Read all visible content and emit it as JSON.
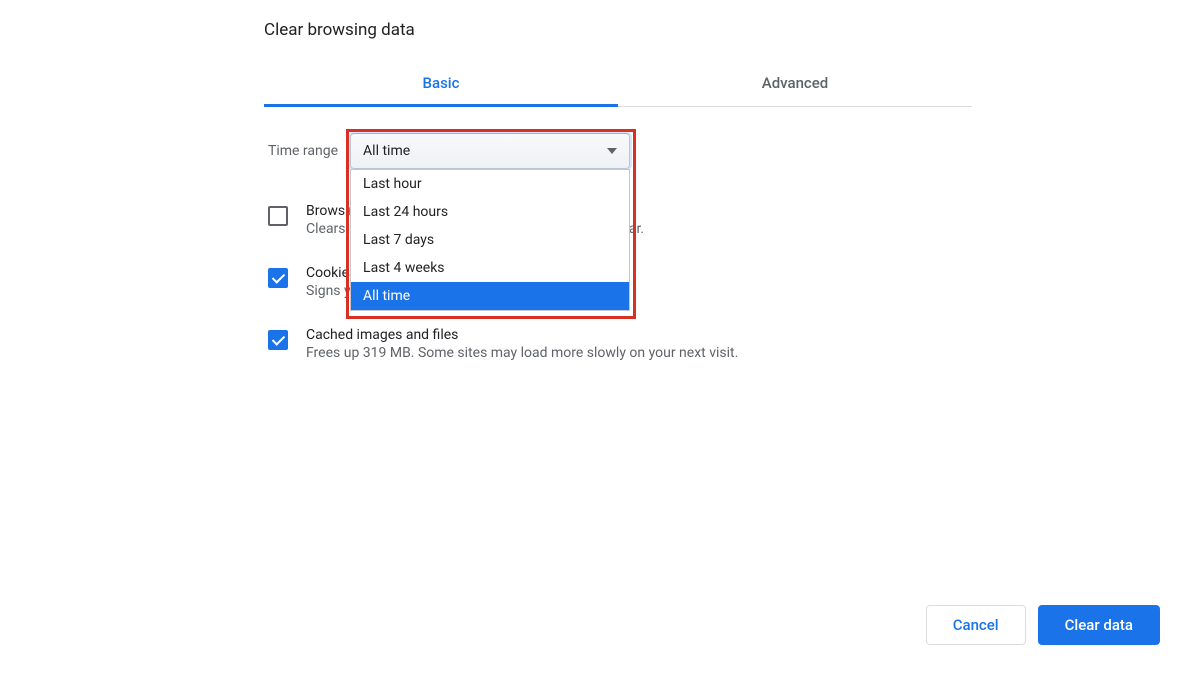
{
  "dialog": {
    "title": "Clear browsing data",
    "tabs": [
      {
        "label": "Basic",
        "active": true
      },
      {
        "label": "Advanced",
        "active": false
      }
    ],
    "time_range": {
      "label": "Time range",
      "selected": "All time",
      "options": [
        "Last hour",
        "Last 24 hours",
        "Last 7 days",
        "Last 4 weeks",
        "All time"
      ]
    },
    "items": [
      {
        "checked": false,
        "title": "Browsing history",
        "description": "Clears history and autocompletions in the address bar."
      },
      {
        "checked": true,
        "title": "Cookies and other site data",
        "description": "Signs you out of most sites."
      },
      {
        "checked": true,
        "title": "Cached images and files",
        "description": "Frees up 319 MB. Some sites may load more slowly on your next visit."
      }
    ],
    "buttons": {
      "cancel": "Cancel",
      "confirm": "Clear data"
    }
  },
  "colors": {
    "accent": "#1a73e8",
    "annotation": "#d93025"
  }
}
